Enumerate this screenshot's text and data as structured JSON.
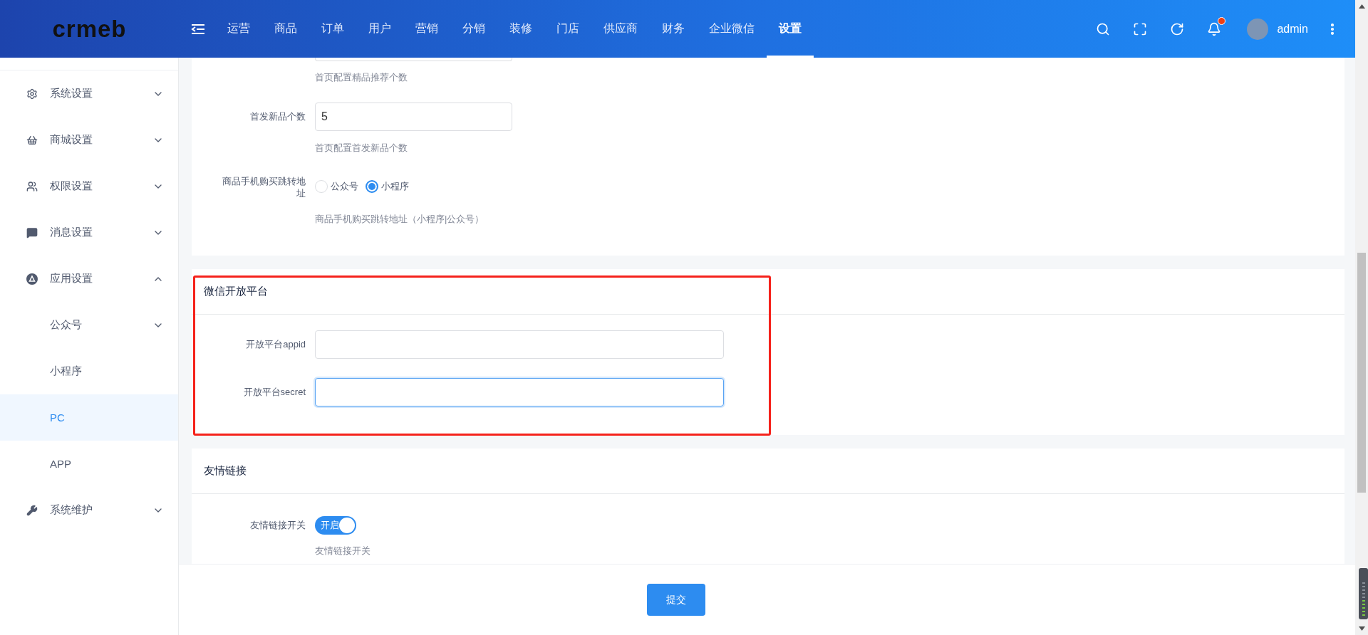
{
  "header": {
    "logo": "crmeb",
    "nav": [
      {
        "label": "运营",
        "selected": false
      },
      {
        "label": "商品",
        "selected": false
      },
      {
        "label": "订单",
        "selected": false
      },
      {
        "label": "用户",
        "selected": false
      },
      {
        "label": "营销",
        "selected": false
      },
      {
        "label": "分销",
        "selected": false
      },
      {
        "label": "装修",
        "selected": false
      },
      {
        "label": "门店",
        "selected": false
      },
      {
        "label": "供应商",
        "selected": false
      },
      {
        "label": "财务",
        "selected": false
      },
      {
        "label": "企业微信",
        "selected": false
      },
      {
        "label": "设置",
        "selected": true
      }
    ],
    "notification": true,
    "user": "admin"
  },
  "sidebar": {
    "items": [
      {
        "label": "系统设置",
        "expanded": false,
        "selected": false
      },
      {
        "label": "商城设置",
        "expanded": false,
        "selected": false
      },
      {
        "label": "权限设置",
        "expanded": false,
        "selected": false
      },
      {
        "label": "消息设置",
        "expanded": false,
        "selected": false
      },
      {
        "label": "应用设置",
        "expanded": true,
        "selected": false,
        "children": [
          {
            "label": "公众号",
            "expanded": false,
            "selected": false
          },
          {
            "label": "小程序",
            "selected": false
          },
          {
            "label": "PC",
            "selected": true
          },
          {
            "label": "APP",
            "selected": false
          }
        ]
      },
      {
        "label": "系统维护",
        "expanded": false,
        "selected": false
      }
    ]
  },
  "sections": [
    {
      "rows": [
        {
          "kind": "cut",
          "hint": "首页配置精品推荐个数"
        },
        {
          "kind": "text",
          "label": "首发新品个数",
          "value": "5",
          "focused": false,
          "hint": "首页配置首发新品个数"
        },
        {
          "kind": "radio",
          "label": "商品手机购买跳转地址",
          "options": [
            {
              "label": "公众号",
              "selected": false
            },
            {
              "label": "小程序",
              "selected": true
            }
          ],
          "hint": "商品手机购买跳转地址（小程序|公众号）"
        }
      ]
    },
    {
      "title": "微信开放平台",
      "highlighted": true,
      "rows": [
        {
          "kind": "text",
          "label": "开放平台appid",
          "focused": false,
          "wide": true
        },
        {
          "kind": "text",
          "label": "开放平台secret",
          "focused": true,
          "wide": true
        }
      ]
    },
    {
      "title": "友情链接",
      "highlighted": false,
      "rows": [
        {
          "kind": "switch",
          "label": "友情链接开关",
          "on": true,
          "on_text": "开启",
          "hint": "友情链接开关"
        }
      ]
    }
  ],
  "footer": {
    "submit": "提交"
  }
}
